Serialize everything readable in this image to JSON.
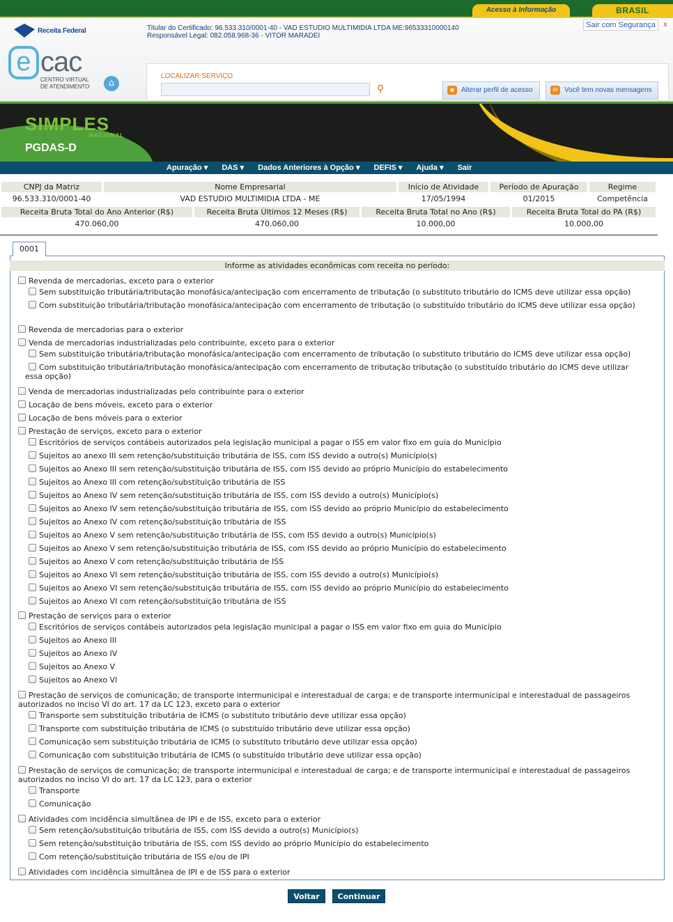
{
  "gov_bar": {
    "acesso_informacao": "Acesso à Informação",
    "brasil": "BRASIL"
  },
  "header": {
    "receita_federal": "Receita Federal",
    "titular_line": "Titular do Certificado: 96.533.310/0001-40 - VAD ESTUDIO MULTIMIDIA LTDA ME:96533310000140",
    "responsavel_line": "Responsável Legal: 082.058.968-36 - VITOR MARADEI",
    "sair_seguranca": "Sair com Segurança",
    "close_x": "x",
    "ecac_e": "e",
    "ecac_cac": "cac",
    "ecac_sub1": "CENTRO VIRTUAL",
    "ecac_sub2": "DE ATENDIMENTO",
    "localizar_label": "LOCALIZAR SERVIÇO",
    "localizar_value": "",
    "alterar_perfil": "Alterar perfil de acesso",
    "novas_mensagens": "Você tem novas mensagens"
  },
  "banner": {
    "simples": "SIMPLES",
    "nacional": "NACIONAL",
    "title": "PGDAS-D"
  },
  "menu": [
    "Apuração ▾",
    "DAS ▾",
    "Dados Anteriores à Opção ▾",
    "DEFIS ▾",
    "Ajuda ▾",
    "Sair"
  ],
  "summary": {
    "row1_headers": [
      "CNPJ da Matriz",
      "Nome Empresarial",
      "Início de Atividade",
      "Período de Apuração",
      "Regime"
    ],
    "row1_values": [
      "96.533.310/0001-40",
      "VAD ESTUDIO MULTIMIDIA LTDA - ME",
      "17/05/1994",
      "01/2015",
      "Competência"
    ],
    "row2_headers": [
      "Receita Bruta Total do Ano Anterior (R$)",
      "Receita Bruta Últimos 12 Meses (R$)",
      "Receita Bruta Total no Ano (R$)",
      "Receita Bruta Total do PA (R$)"
    ],
    "row2_values": [
      "470.060,00",
      "470.060,00",
      "10.000,00",
      "10.000,00"
    ]
  },
  "tab_label": "0001",
  "panel_heading": "Informe as atividades econômicas com receita no período:",
  "options": [
    {
      "level": 0,
      "label": "Revenda de mercadorias, exceto para o exterior"
    },
    {
      "level": 1,
      "label": "Sem substituição tributária/tributação monofásica/antecipação com encerramento de tributação (o substituto tributário do ICMS deve utilizar essa opção)"
    },
    {
      "level": 1,
      "label": "Com substituição tributária/tributação monofásica/antecipação com encerramento de tributação (o substituído tributário do ICMS deve utilizar essa opção)"
    },
    {
      "level": 0,
      "label": "Revenda de mercadorias para o exterior"
    },
    {
      "level": 0,
      "label": "Venda de mercadorias industrializadas pelo contribuinte, exceto para o exterior"
    },
    {
      "level": 1,
      "label": "Sem substituição tributária/tributação monofásica/antecipação com encerramento de tributação (o substituto tributário do ICMS deve utilizar essa opção)"
    },
    {
      "level": 1,
      "label": "Com substituição tributária/tributação monofásica/antecipação com encerramento de tributação tributação (o substituído tributário do ICMS deve utilizar essa opção)"
    },
    {
      "level": 0,
      "label": "Venda de mercadorias industrializadas pelo contribuinte para o exterior"
    },
    {
      "level": 0,
      "label": "Locação de bens móveis, exceto para o exterior"
    },
    {
      "level": 0,
      "label": "Locação de bens móveis para o exterior"
    },
    {
      "level": 0,
      "label": "Prestação de serviços, exceto para o exterior"
    },
    {
      "level": 1,
      "label": "Escritórios de serviços contábeis autorizados pela legislação municipal a pagar o ISS em valor fixo em guia do Município"
    },
    {
      "level": 1,
      "label": "Sujeitos ao anexo III sem retenção/substituição tributária de ISS, com ISS devido a outro(s) Município(s)"
    },
    {
      "level": 1,
      "label": "Sujeitos ao Anexo III sem retenção/substituição tributária de ISS, com ISS devido ao próprio Município do estabelecimento"
    },
    {
      "level": 1,
      "label": "Sujeitos ao Anexo III com retenção/substituição tributária de ISS"
    },
    {
      "level": 1,
      "label": "Sujeitos ao Anexo IV sem retenção/substituição tributária de ISS, com ISS devido a outro(s) Município(s)"
    },
    {
      "level": 1,
      "label": "Sujeitos ao Anexo IV sem retenção/substituição tributária de ISS, com ISS devido ao próprio Município do estabelecimento"
    },
    {
      "level": 1,
      "label": "Sujeitos ao Anexo IV com retenção/substituição tributária de ISS"
    },
    {
      "level": 1,
      "label": "Sujeitos ao Anexo V sem retenção/substituição tributária de ISS, com ISS devido a outro(s) Município(s)"
    },
    {
      "level": 1,
      "label": "Sujeitos ao Anexo V sem retenção/substituição tributária de ISS, com ISS devido ao próprio Município do estabelecimento"
    },
    {
      "level": 1,
      "label": "Sujeitos ao Anexo V com retenção/substituição tributária de ISS"
    },
    {
      "level": 1,
      "label": "Sujeitos ao Anexo VI sem retenção/substituição tributária de ISS, com ISS devido a outro(s) Município(s)"
    },
    {
      "level": 1,
      "label": "Sujeitos ao Anexo VI sem retenção/substituição tributária de ISS, com ISS devido ao próprio Município do estabelecimento"
    },
    {
      "level": 1,
      "label": "Sujeitos ao Anexo VI com retenção/substituição tributária de ISS"
    },
    {
      "level": 0,
      "label": "Prestação de serviços para o exterior"
    },
    {
      "level": 1,
      "label": "Escritórios de serviços contábeis autorizados pela legislação municipal a pagar o ISS em valor fixo em guia do Município"
    },
    {
      "level": 1,
      "label": "Sujeitos ao Anexo III"
    },
    {
      "level": 1,
      "label": "Sujeitos ao Anexo IV"
    },
    {
      "level": 1,
      "label": "Sujeitos ao Anexo V"
    },
    {
      "level": 1,
      "label": "Sujeitos ao Anexo VI"
    },
    {
      "level": 0,
      "label": "Prestação de serviços de comunicação; de transporte intermunicipal e interestadual de carga; e de transporte intermunicipal e interestadual de passageiros autorizados no inciso VI do art. 17 da LC 123, exceto para o exterior"
    },
    {
      "level": 1,
      "label": "Transporte sem substituição tributária de ICMS (o substituto tributário deve utilizar essa opção)"
    },
    {
      "level": 1,
      "label": "Transporte com substituição tributária de ICMS (o substituído tributário deve utilizar essa opção)"
    },
    {
      "level": 1,
      "label": "Comunicação sem substituição tributária de ICMS (o substituto tributário deve utilizar essa opção)"
    },
    {
      "level": 1,
      "label": "Comunicação com substituição tributária de ICMS (o substituído tributário deve utilizar essa opção)"
    },
    {
      "level": 0,
      "label": "Prestação de serviços de comunicação; de transporte intermunicipal e interestadual de carga; e de transporte intermunicipal e interestadual de passageiros autorizados no inciso VI do art. 17 da LC 123, para o exterior"
    },
    {
      "level": 1,
      "label": "Transporte"
    },
    {
      "level": 1,
      "label": "Comunicação"
    },
    {
      "level": 0,
      "label": "Atividades com incidência simultânea de IPI e de ISS, exceto para o exterior"
    },
    {
      "level": 1,
      "label": "Sem retenção/substituição tributária de ISS, com ISS devido a outro(s) Município(s)"
    },
    {
      "level": 1,
      "label": "Sem retenção/substituição tributária de ISS, com ISS devido ao próprio Município do estabelecimento"
    },
    {
      "level": 1,
      "label": "Com retenção/substituição tributária de ISS e/ou de IPI"
    },
    {
      "level": 0,
      "label": "Atividades com incidência simultânea de IPI e de ISS para o exterior"
    }
  ],
  "buttons": {
    "voltar": "Voltar",
    "continuar": "Continuar"
  }
}
